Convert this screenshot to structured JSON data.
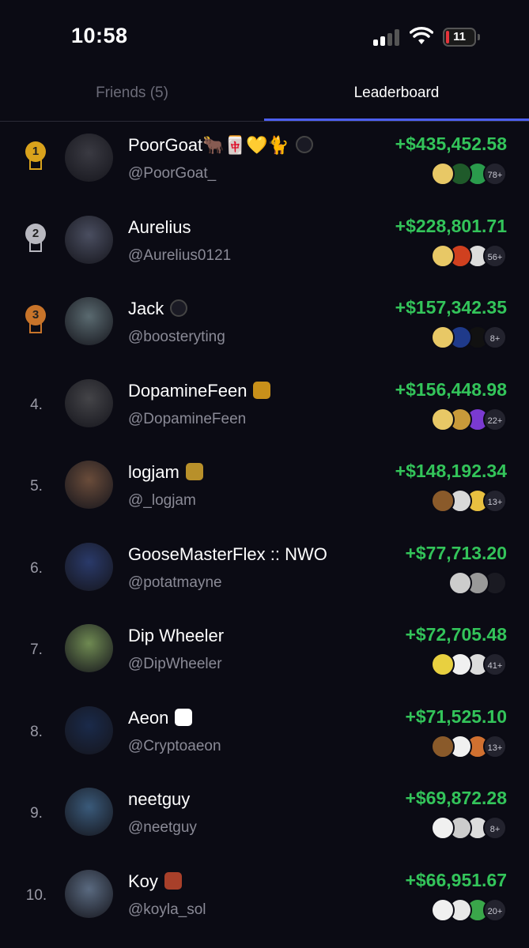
{
  "status_bar": {
    "time": "10:58",
    "battery": "11",
    "battery_level": 0.11,
    "signal_bars": 2
  },
  "tabs": [
    {
      "label": "Friends (5)",
      "active": false
    },
    {
      "label": "Leaderboard",
      "active": true
    }
  ],
  "colors": {
    "accent": "#4d5ff0",
    "positive": "#33c45a",
    "gold": "#d9a21c",
    "silver": "#b8b8c0",
    "bronze": "#c8742a"
  },
  "leaderboard": [
    {
      "rank": "1",
      "medal": "gold",
      "name": "PoorGoat🐂🀄💛🐈",
      "badge": "eye-badge",
      "handle": "@PoorGoat_",
      "pnl": "+$435,452.58",
      "more": "78+",
      "avatar_color": "#3a3a42",
      "tokens": [
        "#e8c866",
        "#1f5a2a",
        "#2a9b4c"
      ]
    },
    {
      "rank": "2",
      "medal": "silver",
      "name": "Aurelius",
      "badge": "",
      "handle": "@Aurelius0121",
      "pnl": "+$228,801.71",
      "more": "56+",
      "avatar_color": "#4a4e60",
      "tokens": [
        "#e8c866",
        "#d0401f",
        "#dcdcdc"
      ]
    },
    {
      "rank": "3",
      "medal": "bronze",
      "name": "Jack",
      "badge": "eye-badge",
      "handle": "@boosteryting",
      "pnl": "+$157,342.35",
      "more": "8+",
      "avatar_color": "#5a6a70",
      "tokens": [
        "#e8c866",
        "#1f3a8a",
        "#111111"
      ]
    },
    {
      "rank": "4.",
      "medal": "",
      "name": "DopamineFeen",
      "badge": "batman-badge",
      "handle": "@DopamineFeen",
      "pnl": "+$156,448.98",
      "more": "22+",
      "avatar_color": "#444448",
      "tokens": [
        "#e8c866",
        "#c89a3a",
        "#7a3ad0"
      ]
    },
    {
      "rank": "5.",
      "medal": "",
      "name": "logjam",
      "badge": "office-badge",
      "handle": "@_logjam",
      "pnl": "+$148,192.34",
      "more": "13+",
      "avatar_color": "#6a4c3a",
      "tokens": [
        "#8a5a2a",
        "#d8d8d8",
        "#e8c040"
      ]
    },
    {
      "rank": "6.",
      "medal": "",
      "name": "GooseMasterFlex :: NWO",
      "badge": "",
      "handle": "@potatmayne",
      "pnl": "+$77,713.20",
      "more": "",
      "avatar_color": "#2a3a6a",
      "tokens": [
        "#cccccc",
        "#999999",
        "#1a1a22"
      ]
    },
    {
      "rank": "7.",
      "medal": "",
      "name": "Dip Wheeler",
      "badge": "",
      "handle": "@DipWheeler",
      "pnl": "+$72,705.48",
      "more": "41+",
      "avatar_color": "#6f8a52",
      "tokens": [
        "#e8d040",
        "#f0f0f0",
        "#dcdcdc"
      ]
    },
    {
      "rank": "8.",
      "medal": "",
      "name": "Aeon",
      "badge": "octo-badge",
      "handle": "@Cryptoaeon",
      "pnl": "+$71,525.10",
      "more": "13+",
      "avatar_color": "#1a2a4a",
      "tokens": [
        "#8a5a2a",
        "#f0f0f0",
        "#d07030"
      ]
    },
    {
      "rank": "9.",
      "medal": "",
      "name": "neetguy",
      "badge": "",
      "handle": "@neetguy",
      "pnl": "+$69,872.28",
      "more": "8+",
      "avatar_color": "#3a5a7a",
      "tokens": [
        "#f0f0f0",
        "#cccccc",
        "#dcdcdc"
      ]
    },
    {
      "rank": "10.",
      "medal": "",
      "name": "Koy",
      "badge": "wanted-badge",
      "handle": "@koyla_sol",
      "pnl": "+$66,951.67",
      "more": "20+",
      "avatar_color": "#5a6a80",
      "tokens": [
        "#f0f0f0",
        "#e8e8e8",
        "#3aa64a"
      ]
    }
  ]
}
